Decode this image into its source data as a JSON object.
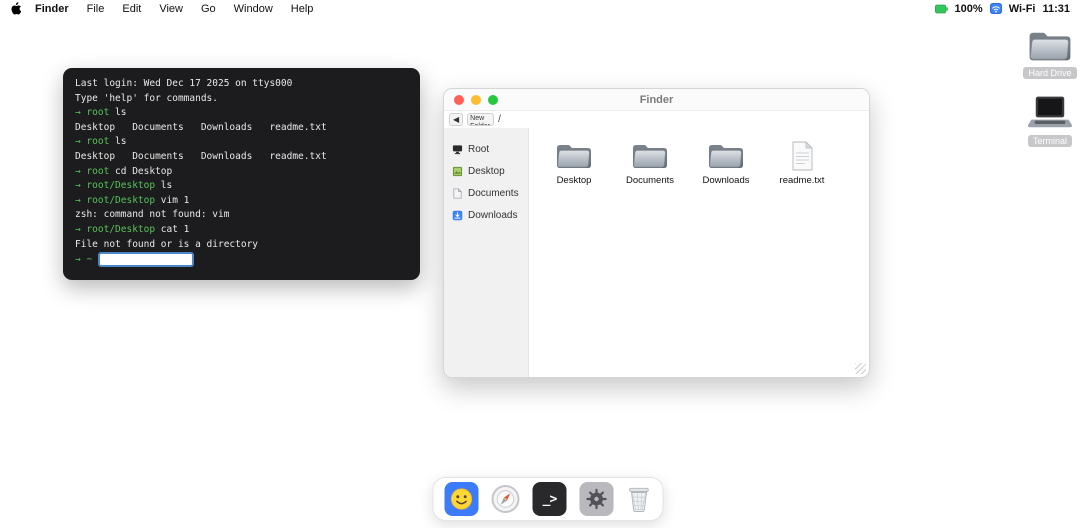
{
  "menu_bar": {
    "items": [
      {
        "label": "Finder"
      },
      {
        "label": "File"
      },
      {
        "label": "Edit"
      },
      {
        "label": "View"
      },
      {
        "label": "Go"
      },
      {
        "label": "Window"
      },
      {
        "label": "Help"
      }
    ],
    "status": {
      "battery_percent": "100%",
      "wifi_label": "Wi-Fi",
      "time": "11:31"
    }
  },
  "desktop_icons": [
    {
      "label": "Hard Drive",
      "icon": "folder-icon"
    },
    {
      "label": "Terminal",
      "icon": "laptop-icon"
    }
  ],
  "terminal": {
    "lines": [
      {
        "prompt": "",
        "text": "Last login: Wed Dec 17 2025 on ttys000"
      },
      {
        "prompt": "",
        "text": "Type 'help' for commands."
      },
      {
        "prompt": "→ root",
        "text": " ls"
      },
      {
        "prompt": "",
        "text": "Desktop   Documents   Downloads   readme.txt"
      },
      {
        "prompt": "→ root",
        "text": " ls"
      },
      {
        "prompt": "",
        "text": "Desktop   Documents   Downloads   readme.txt"
      },
      {
        "prompt": "→ root",
        "text": " cd Desktop"
      },
      {
        "prompt": "→ root/Desktop",
        "text": " ls"
      },
      {
        "prompt": "→ root/Desktop",
        "text": " vim 1"
      },
      {
        "prompt": "",
        "text": "zsh: command not found: vim"
      },
      {
        "prompt": "→ root/Desktop",
        "text": " cat 1"
      },
      {
        "prompt": "",
        "text": "File not found or is a directory"
      },
      {
        "prompt": "→ ~",
        "text": ""
      }
    ],
    "input_value": "",
    "prompt_color": "#57c357",
    "background_color": "#1c1c1e"
  },
  "finder": {
    "title": "Finder",
    "toolbar": {
      "back": "◀",
      "new_folder": "New Folder",
      "path": "/"
    },
    "sidebar": [
      {
        "label": "Root",
        "icon": "monitor-icon"
      },
      {
        "label": "Desktop",
        "icon": "picture-icon"
      },
      {
        "label": "Documents",
        "icon": "document-icon"
      },
      {
        "label": "Downloads",
        "icon": "download-icon"
      }
    ],
    "items": [
      {
        "label": "Desktop",
        "type": "folder"
      },
      {
        "label": "Documents",
        "type": "folder"
      },
      {
        "label": "Downloads",
        "type": "folder"
      },
      {
        "label": "readme.txt",
        "type": "file"
      }
    ]
  },
  "dock": {
    "items": [
      {
        "name": "finder",
        "icon": "smiley-icon"
      },
      {
        "name": "browser",
        "icon": "compass-icon"
      },
      {
        "name": "terminal",
        "icon": "terminal-prompt-icon",
        "glyph": "_>"
      },
      {
        "name": "settings",
        "icon": "gear-icon"
      },
      {
        "name": "trash",
        "icon": "trash-icon"
      }
    ]
  },
  "colors": {
    "dock_finder_bg": "#3d7bfd",
    "dock_terminal_bg": "#29292c",
    "battery_green": "#34c759",
    "wifi_blue": "#3b82f6",
    "traffic_red": "#ff5f57",
    "traffic_yellow": "#febc2e",
    "traffic_green": "#28c840"
  }
}
